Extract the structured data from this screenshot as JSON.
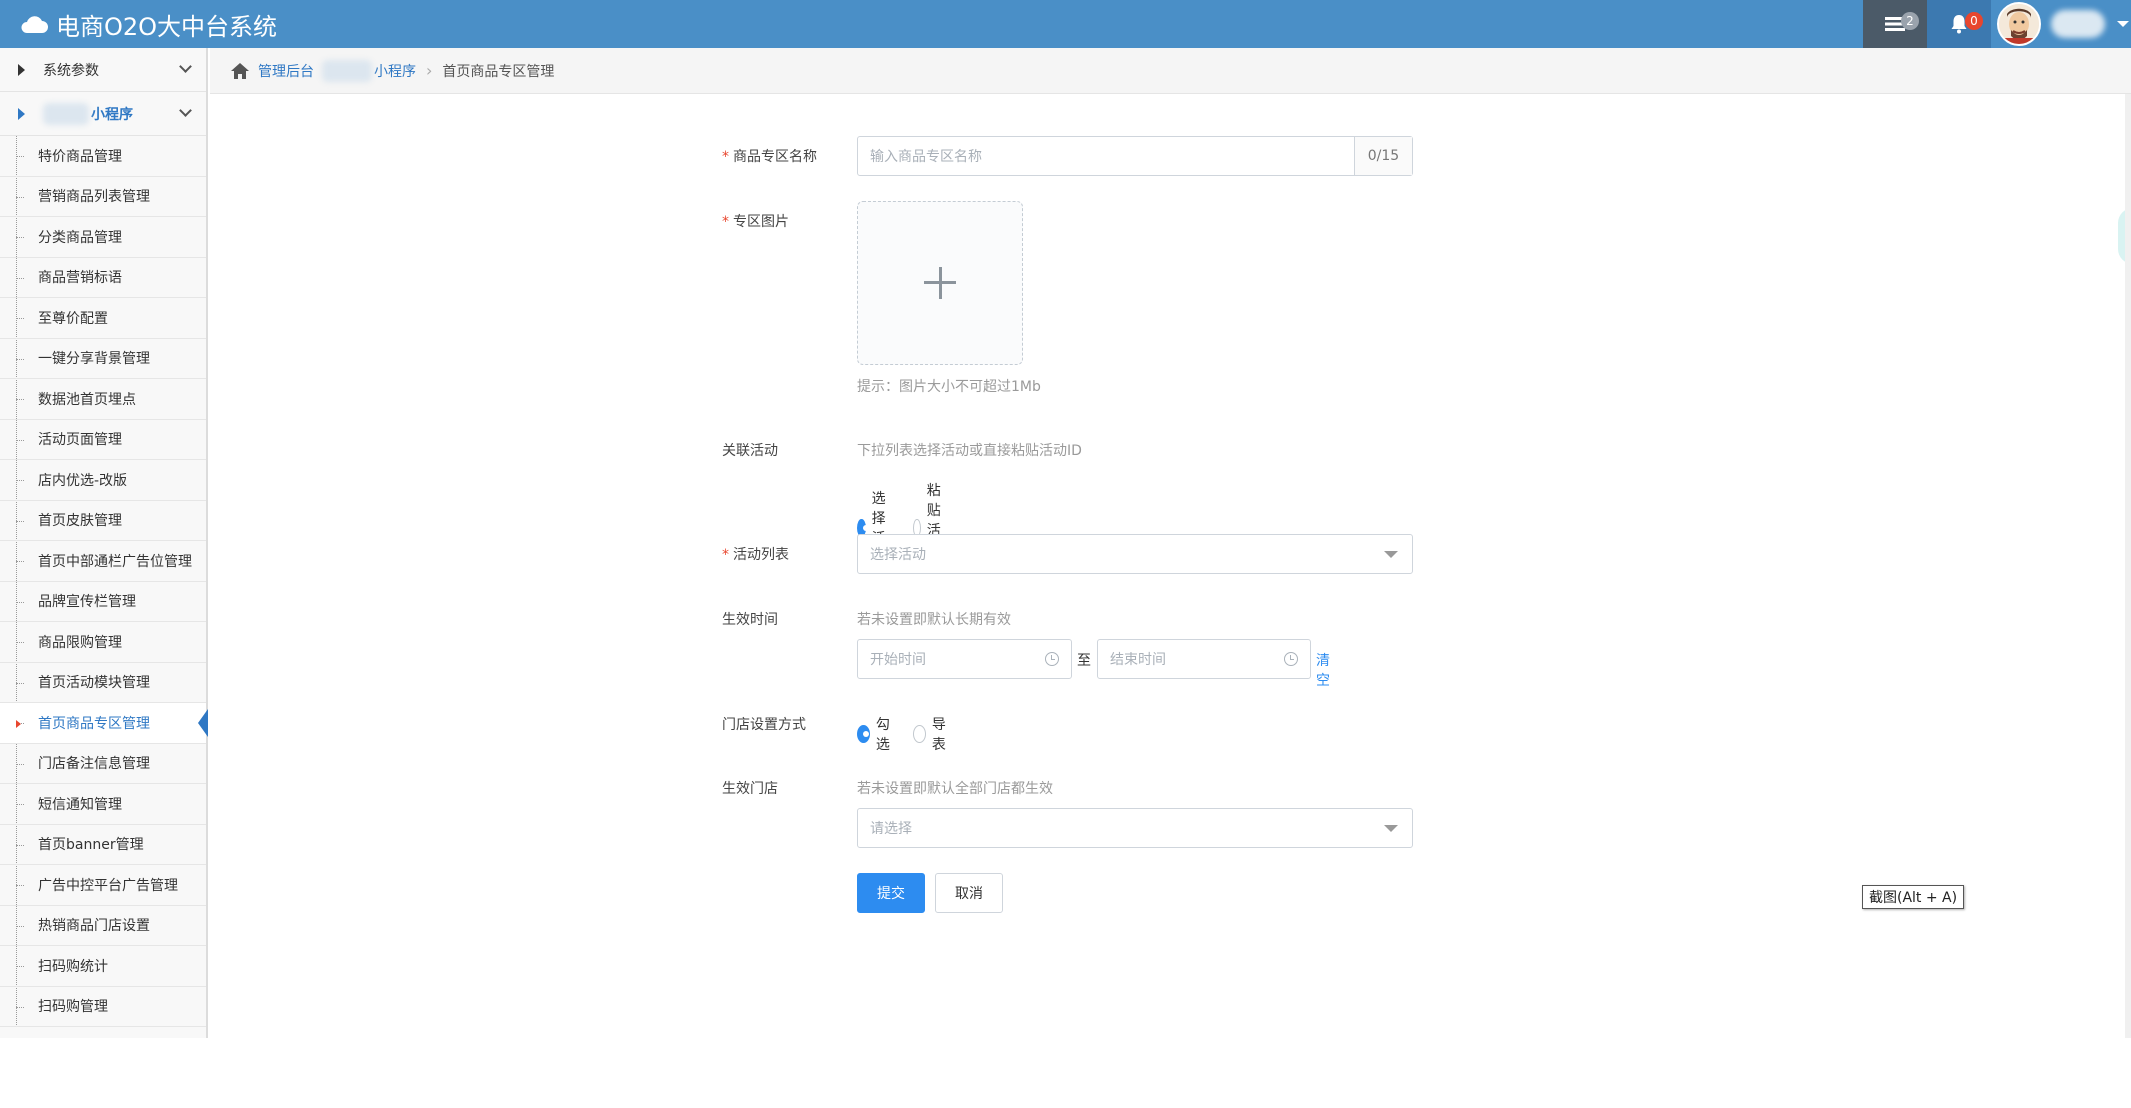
{
  "header": {
    "title": "电商O2O大中台系统",
    "messages_count": "2",
    "notifications_count": "0"
  },
  "sidebar": {
    "groups": [
      {
        "label": "系统参数"
      },
      {
        "label": "小程序"
      }
    ],
    "items": [
      {
        "label": "特价商品管理"
      },
      {
        "label": "营销商品列表管理"
      },
      {
        "label": "分类商品管理"
      },
      {
        "label": "商品营销标语"
      },
      {
        "label": "至尊价配置"
      },
      {
        "label": "一键分享背景管理"
      },
      {
        "label": "数据池首页埋点"
      },
      {
        "label": "活动页面管理"
      },
      {
        "label": "店内优选-改版"
      },
      {
        "label": "首页皮肤管理"
      },
      {
        "label": "首页中部通栏广告位管理"
      },
      {
        "label": "品牌宣传栏管理"
      },
      {
        "label": "商品限购管理"
      },
      {
        "label": "首页活动模块管理"
      },
      {
        "label": "首页商品专区管理"
      },
      {
        "label": "门店备注信息管理"
      },
      {
        "label": "短信通知管理"
      },
      {
        "label": "首页banner管理"
      },
      {
        "label": "广告中控平台广告管理"
      },
      {
        "label": "热销商品门店设置"
      },
      {
        "label": "扫码购统计"
      },
      {
        "label": "扫码购管理"
      }
    ]
  },
  "breadcrumb": {
    "home": "管理后台",
    "section": "小程序",
    "current": "首页商品专区管理"
  },
  "form": {
    "zone_name": {
      "label": "商品专区名称",
      "placeholder": "输入商品专区名称",
      "counter": "0/15"
    },
    "zone_image": {
      "label": "专区图片",
      "tip": "提示：图片大小不可超过1Mb"
    },
    "activity": {
      "label": "关联活动",
      "hint": "下拉列表选择活动或直接粘贴活动ID",
      "options": [
        "选择活动",
        "粘贴活动ID"
      ],
      "selected": "选择活动"
    },
    "activity_list": {
      "label": "活动列表",
      "placeholder": "选择活动"
    },
    "effective_time": {
      "label": "生效时间",
      "hint": "若未设置即默认长期有效",
      "start_placeholder": "开始时间",
      "to": "至",
      "end_placeholder": "结束时间",
      "clear": "清空"
    },
    "store_mode": {
      "label": "门店设置方式",
      "options": [
        "勾选",
        "导表"
      ],
      "selected": "勾选"
    },
    "effective_store": {
      "label": "生效门店",
      "hint": "若未设置即默认全部门店都生效",
      "placeholder": "请选择"
    },
    "submit": "提交",
    "cancel": "取消"
  },
  "tooltip": "截图(Alt + A)",
  "colors": {
    "topbar": "#4a8fc7",
    "primary": "#2d8cf0",
    "required": "#e8462e",
    "link": "#2f78c4"
  }
}
